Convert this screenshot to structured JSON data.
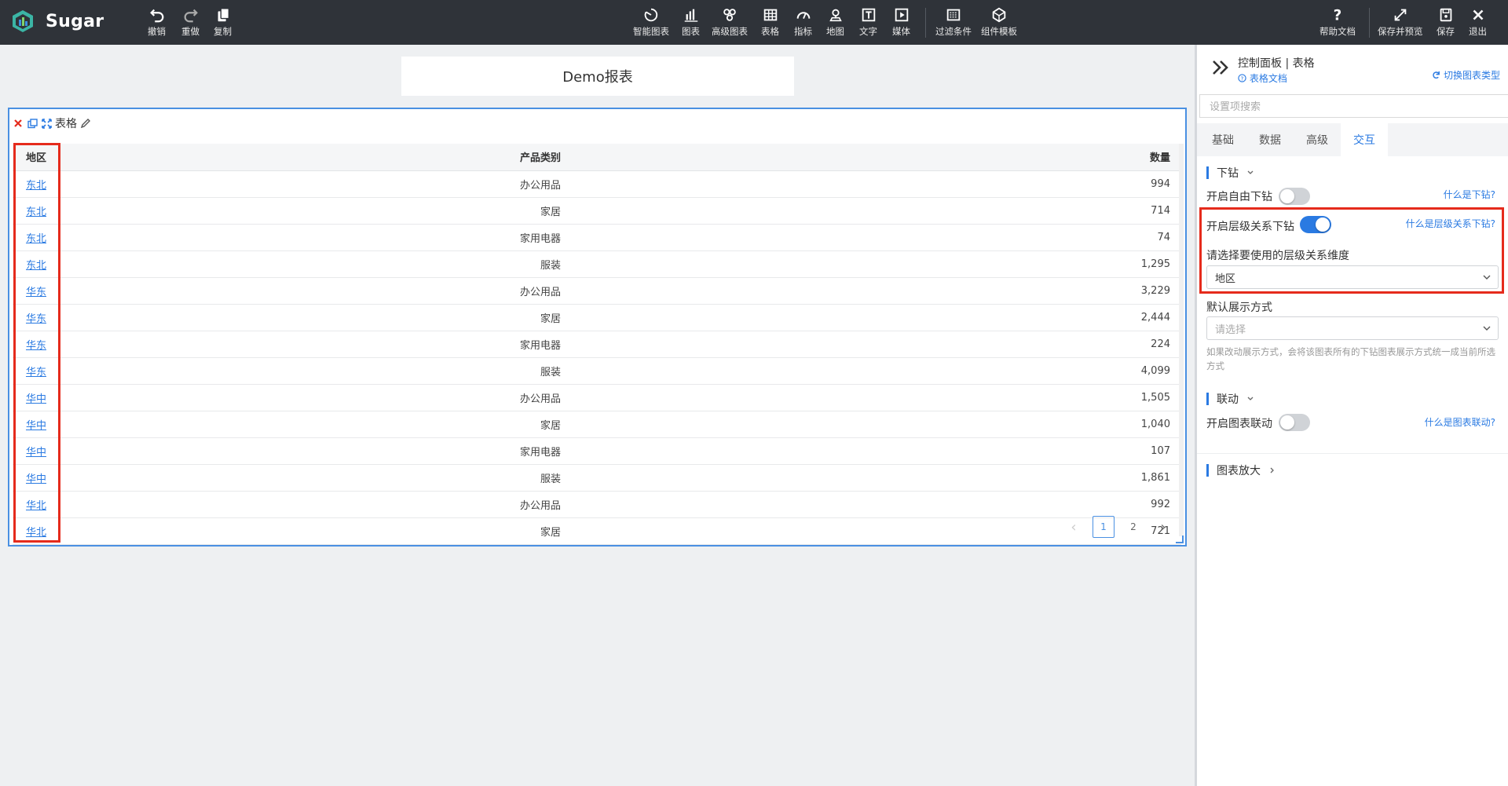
{
  "app": {
    "name": "Sugar"
  },
  "toolbar": {
    "undo": "撤销",
    "redo": "重做",
    "copy": "复制",
    "smart_chart": "智能图表",
    "chart": "图表",
    "advanced_chart": "高级图表",
    "table": "表格",
    "indicator": "指标",
    "map": "地图",
    "text": "文字",
    "media": "媒体",
    "filter": "过滤条件",
    "component_template": "组件模板",
    "help_doc": "帮助文档",
    "save_preview": "保存并预览",
    "save": "保存",
    "exit": "退出"
  },
  "report": {
    "title": "Demo报表"
  },
  "widget": {
    "title": "表格",
    "columns": [
      "地区",
      "产品类别",
      "数量"
    ],
    "rows": [
      {
        "region": "东北",
        "category": "办公用品",
        "qty": "994"
      },
      {
        "region": "东北",
        "category": "家居",
        "qty": "714"
      },
      {
        "region": "东北",
        "category": "家用电器",
        "qty": "74"
      },
      {
        "region": "东北",
        "category": "服装",
        "qty": "1,295"
      },
      {
        "region": "华东",
        "category": "办公用品",
        "qty": "3,229"
      },
      {
        "region": "华东",
        "category": "家居",
        "qty": "2,444"
      },
      {
        "region": "华东",
        "category": "家用电器",
        "qty": "224"
      },
      {
        "region": "华东",
        "category": "服装",
        "qty": "4,099"
      },
      {
        "region": "华中",
        "category": "办公用品",
        "qty": "1,505"
      },
      {
        "region": "华中",
        "category": "家居",
        "qty": "1,040"
      },
      {
        "region": "华中",
        "category": "家用电器",
        "qty": "107"
      },
      {
        "region": "华中",
        "category": "服装",
        "qty": "1,861"
      },
      {
        "region": "华北",
        "category": "办公用品",
        "qty": "992"
      },
      {
        "region": "华北",
        "category": "家居",
        "qty": "721"
      }
    ],
    "pagination": {
      "prev": "‹",
      "pages": [
        "1",
        "2"
      ],
      "next": "›",
      "current": "1"
    }
  },
  "panel": {
    "title": "控制面板 | 表格",
    "doc_link": "表格文档",
    "switch_link": "切换图表类型",
    "search_placeholder": "设置项搜索",
    "tabs": [
      "基础",
      "数据",
      "高级",
      "交互"
    ],
    "active_tab": "交互",
    "drill": {
      "section": "下钻",
      "free_drill_label": "开启自由下钻",
      "free_drill_on": false,
      "free_drill_help": "什么是下钻?",
      "hier_drill_label": "开启层级关系下钻",
      "hier_drill_on": true,
      "hier_drill_help": "什么是层级关系下钻?",
      "dimension_label": "请选择要使用的层级关系维度",
      "dimension_value": "地区",
      "display_label": "默认展示方式",
      "display_placeholder": "请选择",
      "display_hint": "如果改动展示方式，会将该图表所有的下钻图表展示方式统一成当前所选方式"
    },
    "linkage": {
      "section": "联动",
      "label": "开启图表联动",
      "on": false,
      "help": "什么是图表联动?"
    },
    "zoom": {
      "section": "图表放大"
    }
  },
  "colors": {
    "accent": "#2a7ae2",
    "highlight": "#e52b1c",
    "topbar": "#2f3339"
  }
}
